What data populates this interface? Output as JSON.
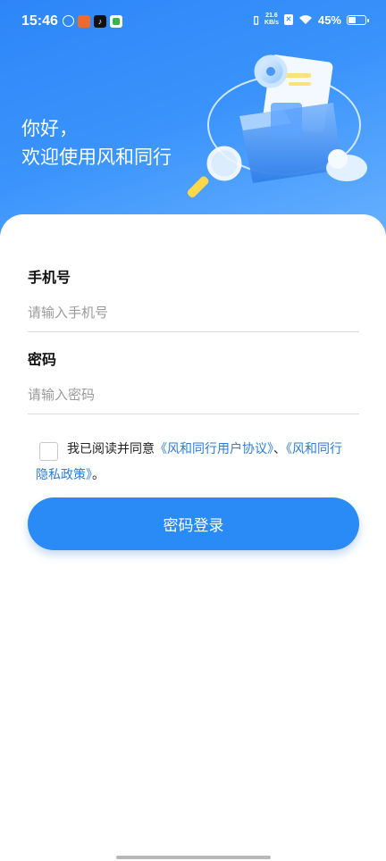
{
  "status_bar": {
    "time": "15:46",
    "net_speed_value": "21.6",
    "net_speed_unit": "KB/s",
    "battery": "45%",
    "battery_level": 0.45
  },
  "header": {
    "greeting_line1": "你好，",
    "greeting_line2": "欢迎使用风和同行"
  },
  "form": {
    "phone_label": "手机号",
    "phone_placeholder": "请输入手机号",
    "password_label": "密码",
    "password_placeholder": "请输入密码"
  },
  "agreement": {
    "checked": false,
    "prefix": "我已阅读并同意",
    "link1": "《风和同行用户协议》",
    "separator": "、",
    "link2_part1": "《风和同行",
    "link2_part2": "隐私政策》",
    "suffix": "。"
  },
  "login_button_label": "密码登录",
  "colors": {
    "brand_blue": "#2a8bf7",
    "link_blue": "#2e7bd8"
  }
}
